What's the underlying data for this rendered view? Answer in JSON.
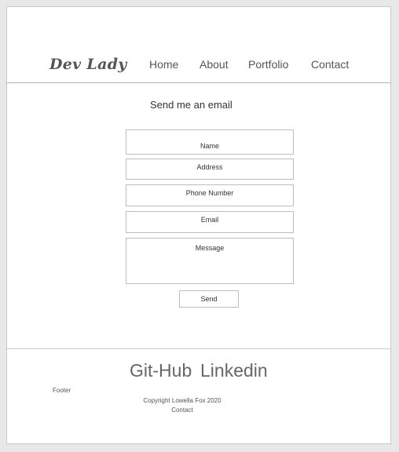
{
  "header": {
    "logo": "Dev Lady",
    "nav": {
      "home": "Home",
      "about": "About",
      "portfolio": "Portfolio",
      "contact": "Contact"
    }
  },
  "form": {
    "title": "Send me an email",
    "fields": {
      "name_placeholder": "Name",
      "address_placeholder": "Address",
      "phone_placeholder": "Phone Number",
      "email_placeholder": "Email",
      "message_placeholder": "Message"
    },
    "send_label": "Send"
  },
  "footer": {
    "github": "Git-Hub",
    "linkedin": "Linkedin",
    "label": "Footer",
    "copyright": "Copyright Lowella Fox 2020",
    "contact": "Contact"
  }
}
